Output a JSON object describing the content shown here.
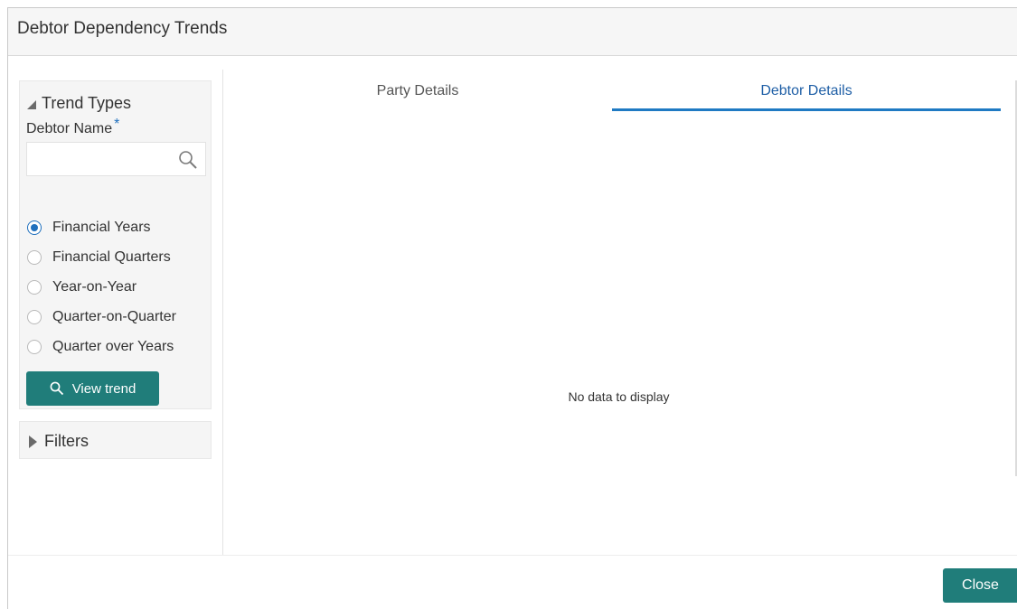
{
  "dialog": {
    "title": "Debtor Dependency Trends"
  },
  "trend_types": {
    "header": "Trend Types",
    "debtor_name_label": "Debtor Name",
    "required_mark": "*",
    "debtor_name_value": "",
    "debtor_name_placeholder": "",
    "options": [
      {
        "label": "Financial Years",
        "checked": true
      },
      {
        "label": "Financial Quarters",
        "checked": false
      },
      {
        "label": "Year-on-Year",
        "checked": false
      },
      {
        "label": "Quarter-on-Quarter",
        "checked": false
      },
      {
        "label": "Quarter over Years",
        "checked": false
      }
    ],
    "view_trend_label": "View trend"
  },
  "filters": {
    "header": "Filters"
  },
  "tabs": [
    {
      "label": "Party Details",
      "active": false
    },
    {
      "label": "Debtor Details",
      "active": true
    }
  ],
  "main": {
    "empty_message": "No data to display"
  },
  "footer": {
    "close_label": "Close"
  },
  "colors": {
    "accent_button": "#207d7a",
    "active_tab": "#1f7ac3",
    "radio_selected": "#1f6fbd"
  },
  "icons": {
    "search": "magnifier-icon",
    "collapse": "triangle-down-icon",
    "expand": "triangle-right-icon"
  }
}
